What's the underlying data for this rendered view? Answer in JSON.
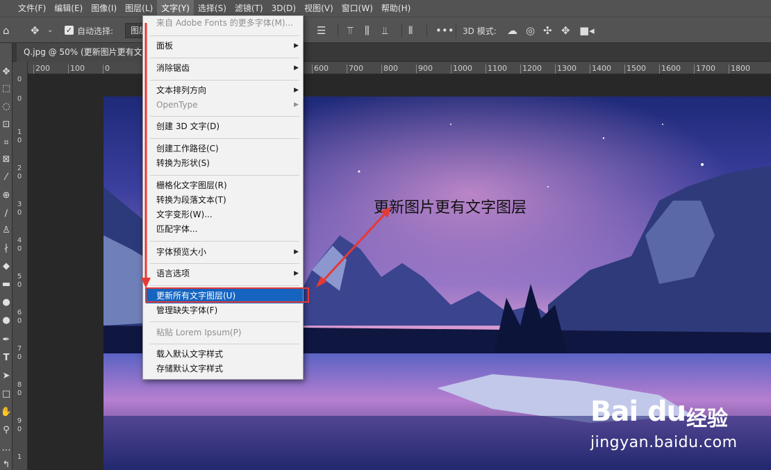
{
  "menubar": {
    "items": [
      "文件(F)",
      "编辑(E)",
      "图像(I)",
      "图层(L)",
      "文字(Y)",
      "选择(S)",
      "滤镜(T)",
      "3D(D)",
      "视图(V)",
      "窗口(W)",
      "帮助(H)"
    ],
    "active_index": 4
  },
  "options": {
    "auto_select_label": "自动选择:",
    "auto_select_value": "图层",
    "mode_label": "3D 模式:"
  },
  "document": {
    "tab_title": "Q.jpg @ 50% (更新图片更有文字"
  },
  "ruler": {
    "h_ticks": [
      "200",
      "100",
      "0",
      "600",
      "700",
      "800",
      "900",
      "1000",
      "1100",
      "1200",
      "1300",
      "1400",
      "1500",
      "1600",
      "1700",
      "1800"
    ],
    "v_ticks": [
      "0",
      "0",
      "1",
      "0",
      "2",
      "0",
      "3",
      "0",
      "4",
      "0",
      "5",
      "0",
      "6",
      "0",
      "7",
      "0",
      "8",
      "0",
      "9",
      "0",
      "1"
    ]
  },
  "dropdown": {
    "items": [
      {
        "label": "来自 Adobe Fonts 的更多字体(M)...",
        "disabled": true,
        "submenu": false
      },
      {
        "label": "面板",
        "disabled": false,
        "submenu": true
      },
      {
        "label": "消除锯齿",
        "disabled": false,
        "submenu": true
      },
      {
        "label": "文本排列方向",
        "disabled": false,
        "submenu": true
      },
      {
        "label": "OpenType",
        "disabled": true,
        "submenu": true
      },
      {
        "label": "创建 3D 文字(D)",
        "disabled": false,
        "submenu": false
      },
      {
        "label": "创建工作路径(C)",
        "disabled": false,
        "submenu": false
      },
      {
        "label": "转换为形状(S)",
        "disabled": false,
        "submenu": false
      },
      {
        "label": "栅格化文字图层(R)",
        "disabled": false,
        "submenu": false
      },
      {
        "label": "转换为段落文本(T)",
        "disabled": false,
        "submenu": false
      },
      {
        "label": "文字变形(W)...",
        "disabled": false,
        "submenu": false
      },
      {
        "label": "匹配字体...",
        "disabled": false,
        "submenu": false
      },
      {
        "label": "字体预览大小",
        "disabled": false,
        "submenu": true
      },
      {
        "label": "语言选项",
        "disabled": false,
        "submenu": true
      },
      {
        "label": "更新所有文字图层(U)",
        "disabled": false,
        "submenu": false,
        "highlighted": true
      },
      {
        "label": "管理缺失字体(F)",
        "disabled": false,
        "submenu": false
      },
      {
        "label": "粘贴 Lorem Ipsum(P)",
        "disabled": true,
        "submenu": false
      },
      {
        "label": "载入默认文字样式",
        "disabled": false,
        "submenu": false
      },
      {
        "label": "存储默认文字样式",
        "disabled": false,
        "submenu": false
      }
    ]
  },
  "canvas_text": "更新图片更有文字图层",
  "watermark": {
    "brand": "Bai",
    "brand_du": "du",
    "cn": "经验",
    "url": "jingyan.baidu.com"
  },
  "colors": {
    "highlight": "#1565c0",
    "annotation_red": "#e53935",
    "panel_bg": "#535353"
  }
}
